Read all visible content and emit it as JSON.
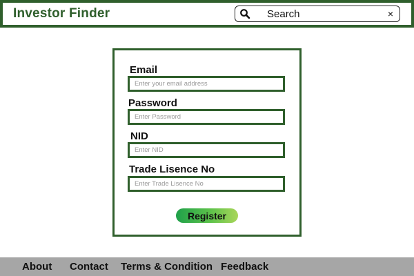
{
  "header": {
    "brand": "Investor Finder",
    "search": {
      "placeholder": "Search",
      "value": "",
      "search_icon": "search-icon",
      "clear_icon": "close-icon",
      "clear_glyph": "×"
    }
  },
  "form": {
    "fields": [
      {
        "label": "Email",
        "placeholder": "Enter your email address",
        "value": ""
      },
      {
        "label": "Password",
        "placeholder": "Enter Password",
        "value": ""
      },
      {
        "label": "NID",
        "placeholder": "Enter NID",
        "value": ""
      },
      {
        "label": "Trade Lisence No",
        "placeholder": "Enter Trade Lisence No",
        "value": ""
      }
    ],
    "register_label": "Register"
  },
  "footer": {
    "links": [
      "About",
      "Contact",
      "Terms & Condition",
      "Feedback"
    ]
  },
  "colors": {
    "accent": "#2f5f2c",
    "footer_bg": "#a6a6a6",
    "button_gradient_start": "#1fa04a",
    "button_gradient_end": "#a9d65a"
  }
}
